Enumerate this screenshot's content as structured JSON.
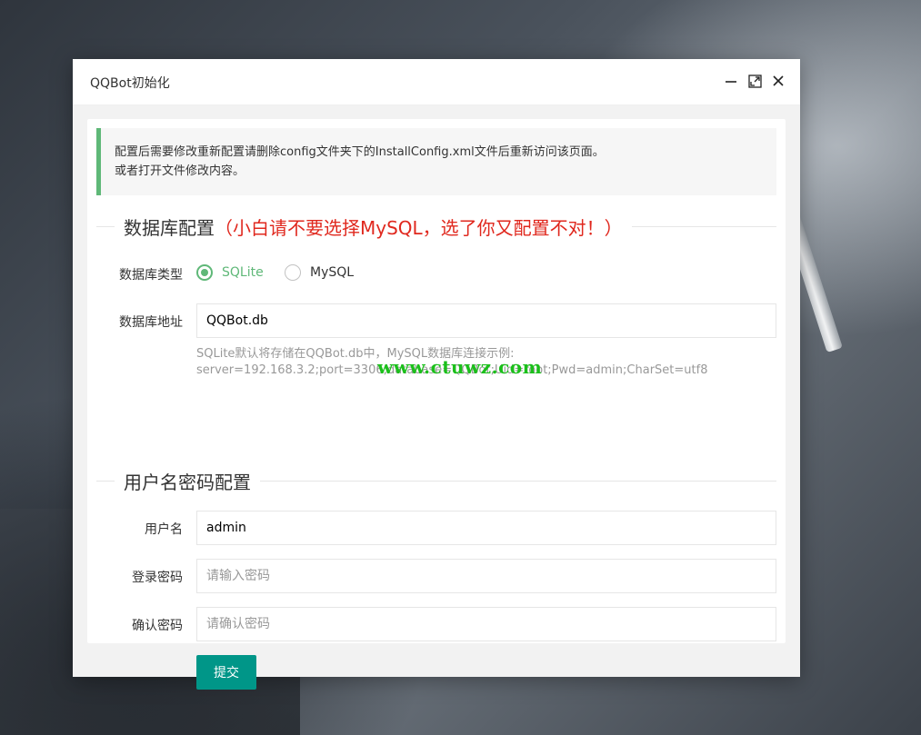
{
  "window": {
    "title": "QQBot初始化"
  },
  "notice": {
    "line1": "配置后需要修改重新配置请删除config文件夹下的InstallConfig.xml文件后重新访问该页面。",
    "line2": "或者打开文件修改内容。",
    "accent_color": "#5fb878"
  },
  "db_section": {
    "title": "数据库配置",
    "warning": "（小白请不要选择MySQL，选了你又配置不对！）",
    "type_label": "数据库类型",
    "options": [
      {
        "label": "SQLite",
        "checked": true
      },
      {
        "label": "MySQL",
        "checked": false
      }
    ],
    "address_label": "数据库地址",
    "address_value": "QQBot.db",
    "help_line1": "SQLite默认将存储在QQBot.db中，MySQL数据库连接示例:",
    "help_line2": "server=192.168.3.2;port=3306;database=QQBot;Uid=root;Pwd=admin;CharSet=utf8"
  },
  "user_section": {
    "title": "用户名密码配置",
    "username_label": "用户名",
    "username_value": "admin",
    "password_label": "登录密码",
    "password_placeholder": "请输入密码",
    "confirm_label": "确认密码",
    "confirm_placeholder": "请确认密码",
    "submit_label": "提交"
  },
  "watermark": "www.ctuwz.com",
  "colors": {
    "primary": "#009688",
    "radio_checked": "#5fb878",
    "warning": "#e0281e"
  }
}
